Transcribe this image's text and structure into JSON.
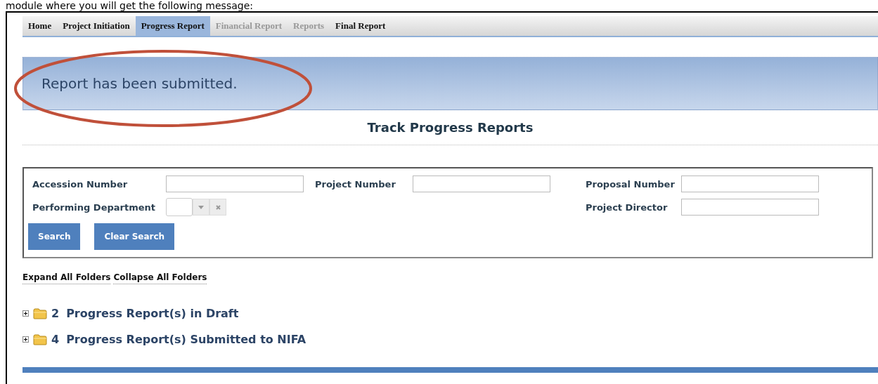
{
  "document_text": "module where you will get the following message:",
  "nav_tabs": [
    {
      "label": "Home",
      "selected": false,
      "disabled": false
    },
    {
      "label": "Project Initiation",
      "selected": false,
      "disabled": false
    },
    {
      "label": "Progress Report",
      "selected": true,
      "disabled": false
    },
    {
      "label": "Financial Report",
      "selected": false,
      "disabled": true
    },
    {
      "label": "Reports",
      "selected": false,
      "disabled": true
    },
    {
      "label": "Final Report",
      "selected": false,
      "disabled": false
    }
  ],
  "message": "Report has been submitted.",
  "annotation": {
    "kind": "ellipse",
    "color": "#c0503a"
  },
  "title": "Track Progress Reports",
  "search_form": {
    "fields": [
      {
        "label": "Accession Number",
        "kind": "text"
      },
      {
        "label": "Project Number",
        "kind": "text"
      },
      {
        "label": "Proposal Number",
        "kind": "text"
      },
      {
        "label": "Performing Department",
        "kind": "combo"
      },
      {
        "label": "Project Director",
        "kind": "text"
      }
    ],
    "buttons": [
      "Search",
      "Clear Search"
    ]
  },
  "folder_links": [
    "Expand All Folders",
    "Collapse All Folders"
  ],
  "folders": [
    {
      "count": "2",
      "label": "Progress Report(s) in Draft",
      "expanded": false
    },
    {
      "count": "4",
      "label": "Progress Report(s) Submitted to NIFA",
      "expanded": false
    }
  ]
}
